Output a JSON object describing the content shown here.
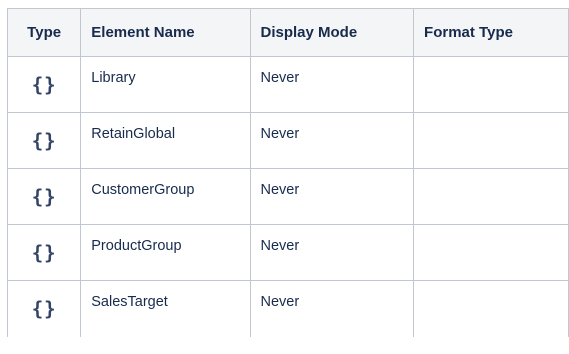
{
  "table": {
    "headers": {
      "type": "Type",
      "element_name": "Element Name",
      "display_mode": "Display Mode",
      "format_type": "Format Type"
    },
    "rows": [
      {
        "type_icon": "curly-braces-icon",
        "element_name": "Library",
        "display_mode": "Never",
        "format_type": ""
      },
      {
        "type_icon": "curly-braces-icon",
        "element_name": "RetainGlobal",
        "display_mode": "Never",
        "format_type": ""
      },
      {
        "type_icon": "curly-braces-icon",
        "element_name": "CustomerGroup",
        "display_mode": "Never",
        "format_type": ""
      },
      {
        "type_icon": "curly-braces-icon",
        "element_name": "ProductGroup",
        "display_mode": "Never",
        "format_type": ""
      },
      {
        "type_icon": "curly-braces-icon",
        "element_name": "SalesTarget",
        "display_mode": "Never",
        "format_type": ""
      }
    ]
  },
  "colors": {
    "header_bg": "#f4f5f7",
    "border": "#c1c7d0",
    "text": "#172b4d",
    "icon": "#344563"
  }
}
